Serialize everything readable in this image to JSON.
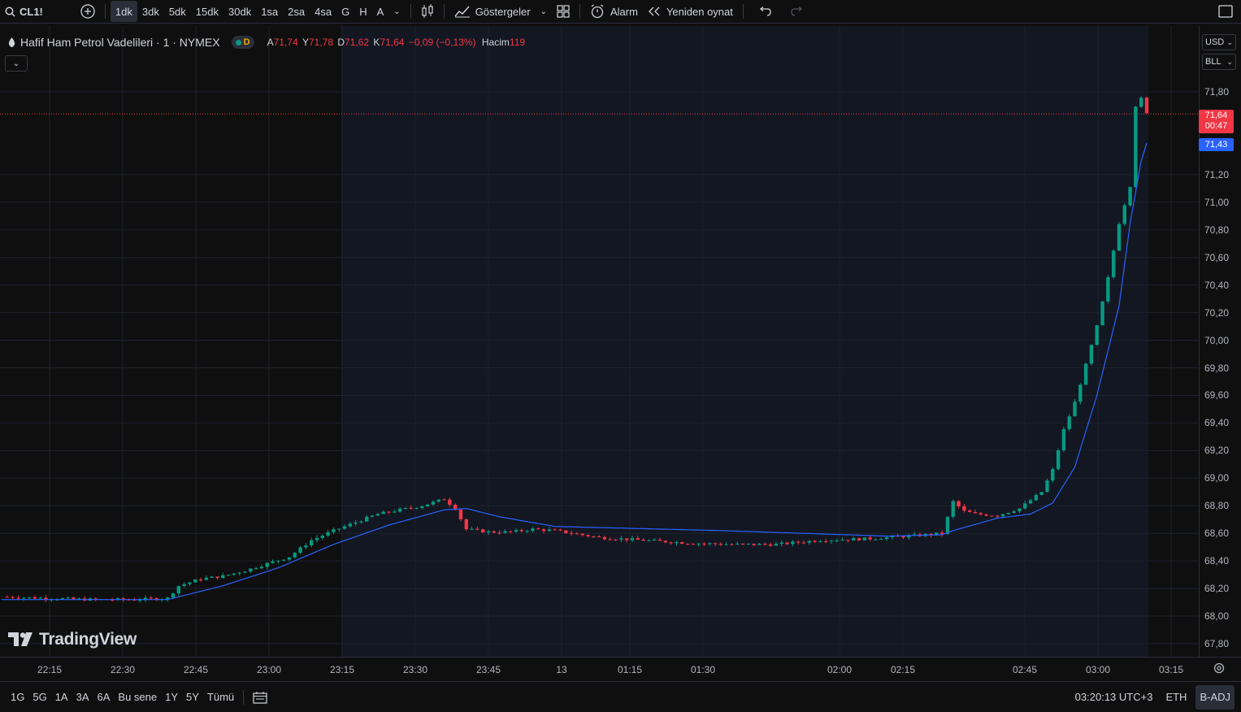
{
  "toolbar": {
    "symbol": "CL1!",
    "intervals": [
      "1dk",
      "3dk",
      "5dk",
      "15dk",
      "30dk",
      "1sa",
      "2sa",
      "4sa",
      "G",
      "H",
      "A"
    ],
    "active_interval": "1dk",
    "indicators_label": "Göstergeler",
    "alarm_label": "Alarm",
    "replay_label": "Yeniden oynat"
  },
  "legend": {
    "title": "Hafif Ham Petrol Vadelileri · 1 · NYMEX",
    "status_letter": "D",
    "open_label": "A",
    "open": "71,74",
    "high_label": "Y",
    "high": "71,78",
    "low_label": "D",
    "low": "71,62",
    "close_label": "K",
    "close": "71,64",
    "change": "−0,09 (−0,13%)",
    "volume_label": "Hacim",
    "volume": "119"
  },
  "price_axis": {
    "currency": "USD",
    "unit": "BLL",
    "labels": [
      "71,80",
      "71,20",
      "71,00",
      "70,80",
      "70,60",
      "70,40",
      "70,20",
      "70,00",
      "69,80",
      "69,60",
      "69,40",
      "69,20",
      "69,00",
      "68,80",
      "68,60",
      "68,40",
      "68,20",
      "68,00",
      "67,80"
    ],
    "last_price": "71,64",
    "countdown": "00:47",
    "ma_value": "71,43"
  },
  "time_axis": {
    "labels": [
      "22:15",
      "22:30",
      "22:45",
      "23:00",
      "23:15",
      "23:30",
      "23:45",
      "13",
      "01:15",
      "01:30",
      "02:00",
      "02:15",
      "02:45",
      "03:00",
      "03:15"
    ]
  },
  "bottom": {
    "ranges": [
      "1G",
      "5G",
      "1A",
      "3A",
      "6A",
      "Bu sene",
      "1Y",
      "5Y",
      "Tümü"
    ],
    "clock": "03:20:13 UTC+3",
    "session": "ETH",
    "adj": "B-ADJ"
  },
  "brand": "TradingView",
  "colors": {
    "up": "#089981",
    "down": "#f23645",
    "ma": "#2962ff",
    "accent": "#2962ff"
  },
  "chart_data": {
    "type": "candlestick",
    "y_range": [
      67.7,
      71.9
    ],
    "last_price": 71.64,
    "ma_last": 71.43,
    "x_labels": [
      "22:15",
      "22:30",
      "22:45",
      "23:00",
      "23:15",
      "23:30",
      "23:45",
      "13",
      "01:15",
      "01:30",
      "02:00",
      "02:15",
      "02:45",
      "03:00",
      "03:15"
    ],
    "close_path": [
      [
        0,
        68.14
      ],
      [
        8,
        68.13
      ],
      [
        16,
        68.12
      ],
      [
        24,
        68.12
      ],
      [
        30,
        68.13
      ],
      [
        32,
        68.22
      ],
      [
        36,
        68.27
      ],
      [
        40,
        68.29
      ],
      [
        44,
        68.33
      ],
      [
        48,
        68.38
      ],
      [
        52,
        68.43
      ],
      [
        56,
        68.55
      ],
      [
        60,
        68.62
      ],
      [
        64,
        68.68
      ],
      [
        68,
        68.74
      ],
      [
        72,
        68.77
      ],
      [
        76,
        68.8
      ],
      [
        80,
        68.85
      ],
      [
        82,
        68.78
      ],
      [
        84,
        68.63
      ],
      [
        88,
        68.61
      ],
      [
        92,
        68.61
      ],
      [
        96,
        68.63
      ],
      [
        100,
        68.62
      ],
      [
        108,
        68.57
      ],
      [
        116,
        68.55
      ],
      [
        124,
        68.53
      ],
      [
        132,
        68.52
      ],
      [
        140,
        68.52
      ],
      [
        148,
        68.55
      ],
      [
        156,
        68.56
      ],
      [
        164,
        68.58
      ],
      [
        170,
        68.6
      ],
      [
        172,
        68.83
      ],
      [
        174,
        68.76
      ],
      [
        176,
        68.74
      ],
      [
        180,
        68.73
      ],
      [
        184,
        68.78
      ],
      [
        188,
        68.9
      ],
      [
        190,
        69.06
      ],
      [
        192,
        69.35
      ],
      [
        194,
        69.55
      ],
      [
        196,
        69.82
      ],
      [
        198,
        70.1
      ],
      [
        200,
        70.45
      ],
      [
        202,
        70.85
      ],
      [
        204,
        71.12
      ],
      [
        205,
        71.7
      ],
      [
        206,
        71.75
      ],
      [
        207,
        71.64
      ]
    ],
    "ma_path": [
      [
        0,
        68.12
      ],
      [
        30,
        68.12
      ],
      [
        40,
        68.22
      ],
      [
        50,
        68.35
      ],
      [
        60,
        68.52
      ],
      [
        70,
        68.66
      ],
      [
        80,
        68.77
      ],
      [
        84,
        68.78
      ],
      [
        90,
        68.72
      ],
      [
        100,
        68.65
      ],
      [
        130,
        68.62
      ],
      [
        160,
        68.58
      ],
      [
        170,
        68.59
      ],
      [
        172,
        68.62
      ],
      [
        180,
        68.71
      ],
      [
        186,
        68.74
      ],
      [
        190,
        68.82
      ],
      [
        194,
        69.08
      ],
      [
        198,
        69.6
      ],
      [
        202,
        70.25
      ],
      [
        204,
        70.85
      ],
      [
        206,
        71.3
      ],
      [
        207,
        71.43
      ]
    ]
  }
}
